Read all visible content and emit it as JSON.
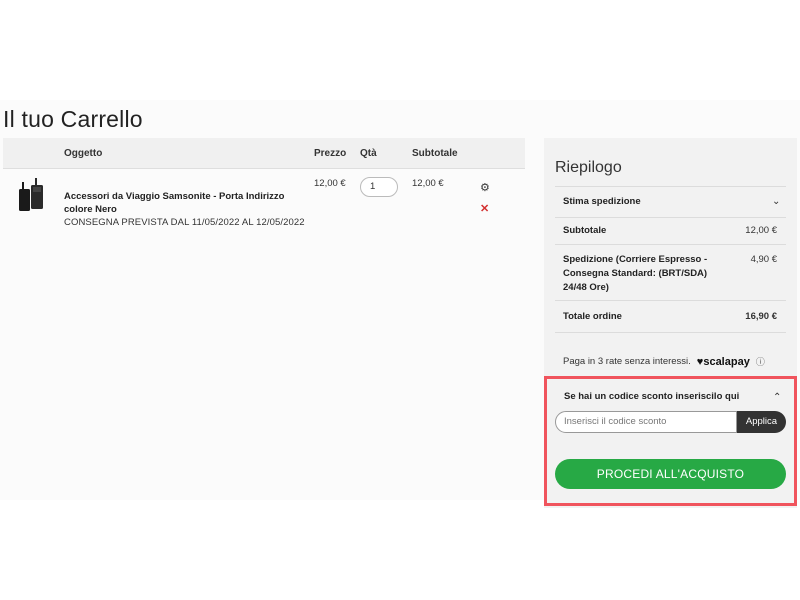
{
  "page": {
    "title": "Il tuo Carrello"
  },
  "cart": {
    "columns": {
      "item": "Oggetto",
      "price": "Prezzo",
      "qty": "Qtà",
      "subtotal": "Subtotale"
    },
    "items": [
      {
        "name": "Accessori da Viaggio Samsonite - Porta Indirizzo colore Nero",
        "delivery": "CONSEGNA PREVISTA DAL 11/05/2022 AL 12/05/2022",
        "price": "12,00 €",
        "qty": "1",
        "subtotal": "12,00 €"
      }
    ],
    "icons": {
      "edit": "gear-icon",
      "remove": "close-icon"
    }
  },
  "summary": {
    "title": "Riepilogo",
    "shipping_estimate_label": "Stima spedizione",
    "subtotal_label": "Subtotale",
    "subtotal_value": "12,00 €",
    "shipping_label": "Spedizione (Corriere Espresso - Consegna Standard: (BRT/SDA) 24/48 Ore)",
    "shipping_value": "4,90 €",
    "total_label": "Totale ordine",
    "total_value": "16,90 €",
    "scalapay_text": "Paga in 3 rate senza interessi.",
    "scalapay_logo": "scalapay"
  },
  "coupon": {
    "title": "Se hai un codice sconto inseriscilo qui",
    "placeholder": "Inserisci il codice sconto",
    "apply_label": "Applica"
  },
  "checkout": {
    "proceed_label": "PROCEDI ALL'ACQUISTO"
  },
  "colors": {
    "accent_green": "#27a945",
    "highlight_red": "#f0545d",
    "remove_red": "#d32f2f"
  }
}
